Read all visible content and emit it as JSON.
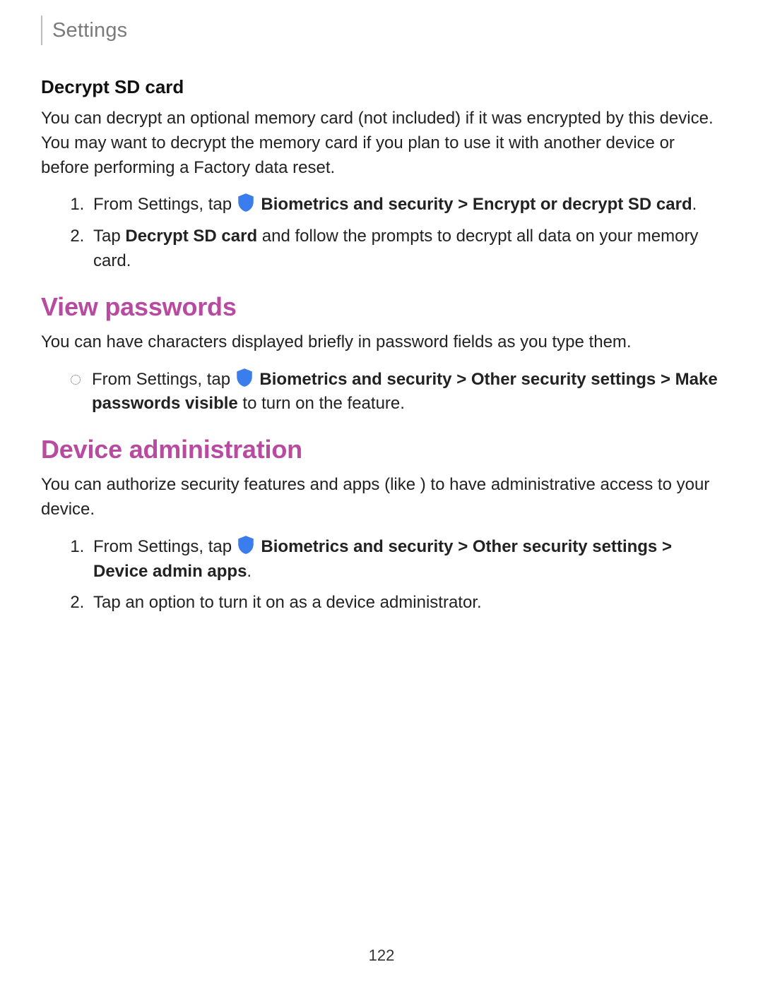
{
  "header": {
    "title": "Settings"
  },
  "section1": {
    "heading": "Decrypt SD card",
    "intro": "You can decrypt an optional memory card (not included) if it was encrypted by this device. You may want to decrypt the memory card if you plan to use it with another device or before performing a Factory data reset.",
    "step1_pre": "From Settings, tap ",
    "step1_bold": "Biometrics and security > Encrypt or decrypt SD card",
    "step1_post": ".",
    "step2_pre": "Tap ",
    "step2_bold": "Decrypt SD card",
    "step2_post": " and follow the prompts to decrypt all data on your memory card."
  },
  "section2": {
    "heading": "View passwords",
    "intro": "You can have characters displayed briefly in password fields as you type them.",
    "bullet_pre": "From Settings, tap ",
    "bullet_bold1": "Biometrics and security > Other security settings > Make passwords visible",
    "bullet_post": " to turn on the feature."
  },
  "section3": {
    "heading": "Device administration",
    "intro": "You can authorize security features and apps (like ) to have administrative access to your device.",
    "step1_pre": "From Settings, tap ",
    "step1_bold": "Biometrics and security > Other security settings > Device admin apps",
    "step1_post": ".",
    "step2": "Tap an option to turn it on as a device administrator."
  },
  "page_number": "122",
  "icon_color": "#3b7ded"
}
